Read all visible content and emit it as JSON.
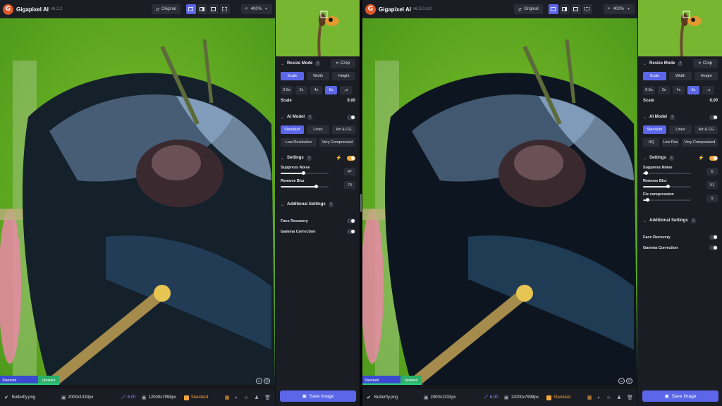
{
  "colors": {
    "accent": "#5b67e8",
    "model": "#f2a63b",
    "updated": "#2bb06a"
  },
  "windows": [
    {
      "app_name": "Gigapixel AI",
      "version": "v6.2.2",
      "original_label": "Original",
      "zoom": "400%",
      "status_model": "Standard",
      "status_state": "Updated",
      "status_progress": 1.0,
      "file_name": "Butterfly.png",
      "input_dims": "2000x1333px",
      "scale_value": "6.00",
      "output_dims": "12000x7998px",
      "model_name": "Standard",
      "resize_mode": {
        "title": "Resize Mode",
        "crop": "Crop",
        "tabs": [
          "Scale",
          "Width",
          "Height"
        ],
        "scales": [
          "0.5x",
          "2x",
          "4x",
          "6x",
          "..x"
        ],
        "active_scale": 3,
        "scale_label": "Scale",
        "scale_value": "6.00"
      },
      "ai_model": {
        "title": "AI Model",
        "row1": [
          "Standard",
          "Lines",
          "Art & CG"
        ],
        "row2": [
          "Low Resolution",
          "Very Compressed"
        ]
      },
      "settings": {
        "title": "Settings",
        "sliders": [
          {
            "name": "Suppress Noise",
            "value": 47
          },
          {
            "name": "Remove Blur",
            "value": 74
          }
        ]
      },
      "additional": {
        "title": "Additional Settings",
        "toggles": [
          "Face Recovery",
          "Gamma Correction"
        ]
      },
      "save_label": "Save Image"
    },
    {
      "app_name": "Gigapixel AI",
      "version": "v6.3.0.rc2",
      "original_label": "Original",
      "zoom": "400%",
      "status_model": "Standard",
      "status_state": "Updated",
      "status_progress": 1.0,
      "file_name": "Butterfly.png",
      "input_dims": "2000x1333px",
      "scale_value": "6.00",
      "output_dims": "12000x7998px",
      "model_name": "Standard",
      "resize_mode": {
        "title": "Resize Mode",
        "crop": "Crop",
        "tabs": [
          "Scale",
          "Width",
          "Height"
        ],
        "scales": [
          "0.5x",
          "2x",
          "4x",
          "6x",
          "..x"
        ],
        "active_scale": 3,
        "scale_label": "Scale",
        "scale_value": "6.00"
      },
      "ai_model": {
        "title": "AI Model",
        "row1": [
          "Standard",
          "Lines",
          "Art & CG"
        ],
        "row2": [
          "HQ",
          "Low Res",
          "Very Compressed"
        ]
      },
      "settings": {
        "title": "Settings",
        "sliders": [
          {
            "name": "Suppress Noise",
            "value": 6
          },
          {
            "name": "Remove Blur",
            "value": 51
          },
          {
            "name": "Fix compression",
            "value": 9
          }
        ]
      },
      "additional": {
        "title": "Additional Settings",
        "toggles": [
          "Face Recovery",
          "Gamma Correction"
        ]
      },
      "save_label": "Save Image"
    }
  ]
}
